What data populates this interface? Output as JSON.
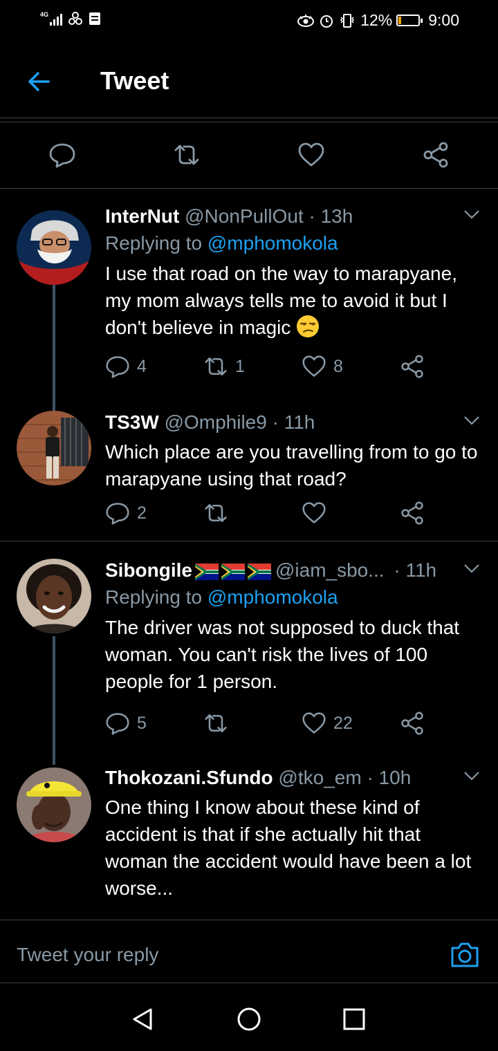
{
  "status_bar": {
    "network": "4G",
    "battery_percent": "12%",
    "battery_level": 0.12,
    "time": "9:00",
    "colors": {
      "battery_fill": "#f4a20b"
    }
  },
  "header": {
    "title": "Tweet",
    "back_icon": "arrow-left-icon"
  },
  "main_tweet_actions": [
    "reply-icon",
    "retweet-icon",
    "like-icon",
    "share-icon"
  ],
  "replies": [
    {
      "name": "InterNut",
      "handle": "@NonPullOut",
      "time": "· 13h",
      "replying_prefix": "Replying to",
      "replying_to": "@mphomokola",
      "text": "I use that road on the way to marapyane, my mom always tells me to avoid it but I don't believe in magic",
      "emoji": "unamused-face",
      "counts": {
        "reply": "4",
        "retweet": "1",
        "like": "8"
      }
    },
    {
      "name": "TS3W",
      "handle": "@Omphile9",
      "time": "· 11h",
      "text": "Which place are you travelling from to go to marapyane using that road?",
      "counts": {
        "reply": "2",
        "retweet": "",
        "like": ""
      }
    },
    {
      "name": "Sibongile",
      "flags": [
        "south-africa-flag",
        "south-africa-flag",
        "south-africa-flag"
      ],
      "handle": "@iam_sbo...",
      "time": "· 11h",
      "replying_prefix": "Replying to",
      "replying_to": "@mphomokola",
      "text": "The driver was not supposed to duck that woman. You can't risk the lives of 100 people for 1 person.",
      "counts": {
        "reply": "5",
        "retweet": "",
        "like": "22"
      }
    },
    {
      "name": "Thokozani.Sfundo",
      "handle": "@tko_em",
      "time": "· 10h",
      "text": "One thing I know about these kind of accident is that if she actually hit that woman the accident would have been a lot worse..."
    }
  ],
  "compose": {
    "placeholder": "Tweet your reply",
    "camera_icon": "camera-icon"
  },
  "navigation": [
    "back-triangle-icon",
    "home-circle-icon",
    "recents-square-icon"
  ],
  "colors": {
    "background": "#000000",
    "accent": "#1da1f2",
    "secondary_text": "#8899a6",
    "divider": "#38444d",
    "thread_line": "#3d5466"
  }
}
